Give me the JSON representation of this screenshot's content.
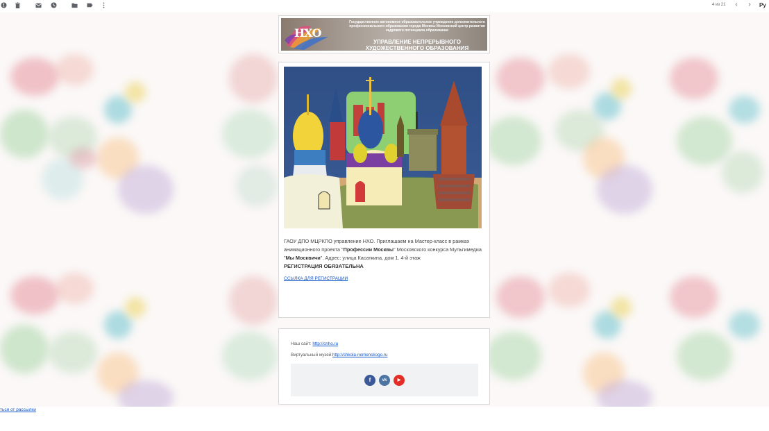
{
  "toolbar": {
    "icons": [
      "report-icon",
      "delete-icon",
      "mark-unread-icon",
      "snooze-icon",
      "move-to-icon",
      "label-icon",
      "more-icon"
    ],
    "pager_text": "4 из 21",
    "lang_label": "Ру"
  },
  "banner": {
    "logo_text": "НХО",
    "org_small": "Государственное автономное образовательное учреждение дополнительного профессионального образования города Москвы Московский центр развития кадрового потенциала образования",
    "org_title": "УПРАВЛЕНИЕ НЕПРЕРЫВНОГО ХУДОЖЕСТВЕННОГО ОБРАЗОВАНИЯ"
  },
  "main": {
    "text_part1": "ГАОУ ДПО МЦРКПО управление НХО. Приглашаем на  Мастер-класс в рамках анимационного проекта \"",
    "project_name": "Профессии Москвы",
    "text_part2": "\" Московского  конкурса Мульгимедиа \"",
    "contest_name": "Мы Москвичи",
    "text_part3": "\". Адрес: улица Касаткина, дом 1. 4-й этаж",
    "registration_note": "РЕГИСТРАЦИЯ ОБЯЗАТЕЛЬНА",
    "registration_link": "ССЫЛКА ДЛЯ РЕГИСТРАЦИИ"
  },
  "footer": {
    "site_label": "Наш сайт: ",
    "site_url": "http://cnho.ru",
    "museum_label": "Виртуальный музей:",
    "museum_url": "http://shkola-nemenskogo.ru",
    "social": [
      {
        "name": "facebook-icon",
        "glyph": "f",
        "color": "#3b5998"
      },
      {
        "name": "vk-icon",
        "glyph": "vk",
        "color": "#4c75a3"
      },
      {
        "name": "youtube-icon",
        "glyph": "▶",
        "color": "#e52d27"
      }
    ]
  },
  "unsubscribe_text": "ться от рассылки"
}
